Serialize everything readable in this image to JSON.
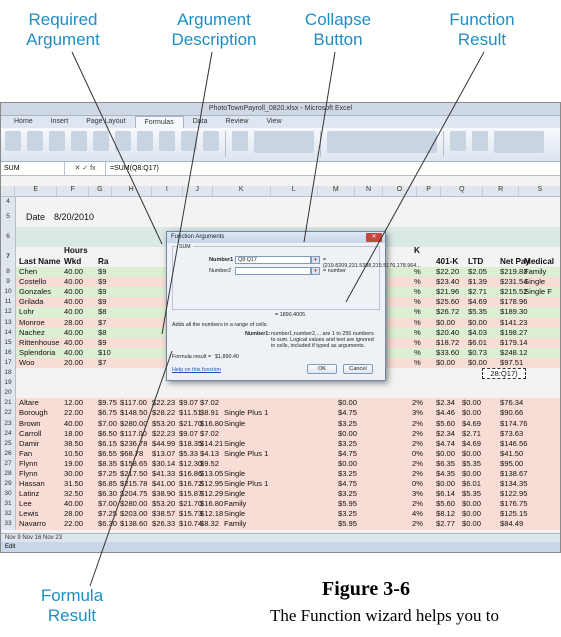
{
  "callouts": {
    "required_argument": [
      "Required",
      "Argument"
    ],
    "argument_description": [
      "Argument",
      "Description"
    ],
    "collapse_button": [
      "Collapse",
      "Button"
    ],
    "function_result": [
      "Function",
      "Result"
    ],
    "formula_result": [
      "Formula",
      "Result"
    ]
  },
  "figure": {
    "number": "Figure 3-6",
    "caption": "The Function wizard helps you to"
  },
  "excel": {
    "title": "PhotoTownPayroll_0820.xlsx - Microsoft Excel",
    "tabs": [
      "Home",
      "Insert",
      "Page Layout",
      "Formulas",
      "Data",
      "Review",
      "View"
    ],
    "active_tab": "Formulas",
    "name_box": "SUM",
    "formula": "=SUM(Q8:Q17)",
    "date_label": "Date",
    "date_value": "8/20/2010",
    "columns": [
      "E",
      "F",
      "G",
      "H",
      "I",
      "J",
      "K",
      "L",
      "M",
      "N",
      "O",
      "P",
      "Q",
      "R",
      "S"
    ],
    "headers": {
      "hours": "Hours",
      "wkd": "Wkd",
      "last_name": "Last Name",
      "rate": "Ra",
      "k": "K",
      "k401": "401-K",
      "ltd": "LTD",
      "net_pay": "Net Pay",
      "medical": "Medical"
    },
    "top_rows": [
      {
        "n": "8",
        "name": "Chen",
        "hours": "40.00",
        "rate": "$9",
        "pct": "%",
        "k401": "$22.20",
        "ltd": "$2.05",
        "net": "$219.83",
        "med": "Family"
      },
      {
        "n": "9",
        "name": "Costello",
        "hours": "40.00",
        "rate": "$9",
        "pct": "%",
        "k401": "$23.40",
        "ltd": "$1.39",
        "net": "$231.54",
        "med": "Single"
      },
      {
        "n": "10",
        "name": "Gonzales",
        "hours": "40.00",
        "rate": "$9",
        "pct": "%",
        "k401": "$21.96",
        "ltd": "$2.71",
        "net": "$215.52",
        "med": "Single F"
      },
      {
        "n": "11",
        "name": "Grilada",
        "hours": "40.00",
        "rate": "$9",
        "pct": "%",
        "k401": "$25.60",
        "ltd": "$4.69",
        "net": "$178.96",
        "med": ""
      },
      {
        "n": "12",
        "name": "Lohr",
        "hours": "40.00",
        "rate": "$8",
        "pct": "%",
        "k401": "$26.72",
        "ltd": "$5.35",
        "net": "$189.30",
        "med": ""
      },
      {
        "n": "13",
        "name": "Monroe",
        "hours": "28.00",
        "rate": "$7",
        "pct": "%",
        "k401": "$0.00",
        "ltd": "$0.00",
        "net": "$141.23",
        "med": ""
      },
      {
        "n": "14",
        "name": "Nachez",
        "hours": "40.00",
        "rate": "$8",
        "pct": "%",
        "k401": "$20.40",
        "ltd": "$4.03",
        "net": "$198.27",
        "med": ""
      },
      {
        "n": "15",
        "name": "Rittenhouse",
        "hours": "40.00",
        "rate": "$9",
        "pct": "%",
        "k401": "$18.72",
        "ltd": "$6.01",
        "net": "$179.14",
        "med": ""
      },
      {
        "n": "16",
        "name": "Splendoria",
        "hours": "40.00",
        "rate": "$10",
        "pct": "%",
        "k401": "$33.60",
        "ltd": "$0.73",
        "net": "$248.12",
        "med": ""
      },
      {
        "n": "17",
        "name": "Woo",
        "hours": "20.00",
        "rate": "$7",
        "pct": "%",
        "k401": "$0.00",
        "ltd": "$0.00",
        "net": "$97.51",
        "med": ""
      }
    ],
    "row18_q": "28:Q17)",
    "bottom_rows": [
      {
        "n": "21",
        "name": "Altare",
        "hours": "12.00",
        "rate": "$9.75",
        "h": "$117.00",
        "i": "$22.23",
        "j": "$9.07",
        "k": "$7.02",
        "l": "",
        "m": "$0.00",
        "pct": "2%",
        "k401": "$2.34",
        "ltd": "$0.00",
        "net": "$76.34"
      },
      {
        "n": "22",
        "name": "Borough",
        "hours": "22.00",
        "rate": "$6.75",
        "h": "$148.50",
        "i": "$28.22",
        "j": "$11.51",
        "k": "$8.91",
        "l": "Single Plus 1",
        "m": "$4.75",
        "pct": "3%",
        "k401": "$4.46",
        "ltd": "$0.00",
        "net": "$90.66"
      },
      {
        "n": "23",
        "name": "Brown",
        "hours": "40.00",
        "rate": "$7.00",
        "h": "$280.00",
        "i": "$53.20",
        "j": "$21.70",
        "k": "$16.80",
        "l": "Single",
        "m": "$3.25",
        "pct": "2%",
        "k401": "$5.60",
        "ltd": "$4.69",
        "net": "$174.76"
      },
      {
        "n": "24",
        "name": "Carroll",
        "hours": "18.00",
        "rate": "$6.50",
        "h": "$117.00",
        "i": "$22.23",
        "j": "$9.07",
        "k": "$7.02",
        "l": "",
        "m": "$0.00",
        "pct": "2%",
        "k401": "$2.34",
        "ltd": "$2.71",
        "net": "$73.63"
      },
      {
        "n": "25",
        "name": "Damir",
        "hours": "38.50",
        "rate": "$6.15",
        "h": "$236.78",
        "i": "$44.99",
        "j": "$18.35",
        "k": "$14.21",
        "l": "Single",
        "m": "$3.25",
        "pct": "2%",
        "k401": "$4.74",
        "ltd": "$4.69",
        "net": "$146.56"
      },
      {
        "n": "26",
        "name": "Fan",
        "hours": "10.50",
        "rate": "$6.55",
        "h": "$68.78",
        "i": "$13.07",
        "j": "$5.33",
        "k": "$4.13",
        "l": "Single Plus 1",
        "m": "$4.75",
        "pct": "0%",
        "k401": "$0.00",
        "ltd": "$0.00",
        "net": "$41.50"
      },
      {
        "n": "27",
        "name": "Flynn",
        "hours": "19.00",
        "rate": "$8.35",
        "h": "$158.65",
        "i": "$30.14",
        "j": "$12.30",
        "k": "$9.52",
        "l": "",
        "m": "$0.00",
        "pct": "2%",
        "k401": "$6.35",
        "ltd": "$5.35",
        "net": "$95.00"
      },
      {
        "n": "28",
        "name": "Flynn",
        "hours": "30.00",
        "rate": "$7.25",
        "h": "$217.50",
        "i": "$41.33",
        "j": "$16.86",
        "k": "$13.05",
        "l": "Single",
        "m": "$3.25",
        "pct": "2%",
        "k401": "$4.35",
        "ltd": "$0.00",
        "net": "$138.67"
      },
      {
        "n": "29",
        "name": "Hassan",
        "hours": "31.50",
        "rate": "$6.85",
        "h": "$215.78",
        "i": "$41.00",
        "j": "$16.72",
        "k": "$12.95",
        "l": "Single Plus 1",
        "m": "$4.75",
        "pct": "0%",
        "k401": "$0.00",
        "ltd": "$6.01",
        "net": "$134.35"
      },
      {
        "n": "30",
        "name": "Latinz",
        "hours": "32.50",
        "rate": "$6.30",
        "h": "$204.75",
        "i": "$38.90",
        "j": "$15.87",
        "k": "$12.29",
        "l": "Single",
        "m": "$3.25",
        "pct": "3%",
        "k401": "$6.14",
        "ltd": "$5.35",
        "net": "$122.95"
      },
      {
        "n": "31",
        "name": "Lee",
        "hours": "40.00",
        "rate": "$7.00",
        "h": "$280.00",
        "i": "$53.20",
        "j": "$21.70",
        "k": "$16.80",
        "l": "Family",
        "m": "$5.95",
        "pct": "2%",
        "k401": "$5.60",
        "ltd": "$0.00",
        "net": "$176.75"
      },
      {
        "n": "32",
        "name": "Lewis",
        "hours": "28.00",
        "rate": "$7.25",
        "h": "$203.00",
        "i": "$38.57",
        "j": "$15.73",
        "k": "$12.18",
        "l": "Single",
        "m": "$3.25",
        "pct": "4%",
        "k401": "$8.12",
        "ltd": "$0.00",
        "net": "$125.15"
      },
      {
        "n": "33",
        "name": "Navarro",
        "hours": "22.00",
        "rate": "$6.30",
        "h": "$138.60",
        "i": "$26.33",
        "j": "$10.74",
        "k": "$8.32",
        "l": "Family",
        "m": "$5.95",
        "pct": "2%",
        "k401": "$2.77",
        "ltd": "$0.00",
        "net": "$84.49"
      }
    ],
    "sheet_tabs": "Nov 9    Nov 16    Nov 23",
    "status": "Edit"
  },
  "dialog": {
    "title": "Function Arguments",
    "function_name": "SUM",
    "number1_label": "Number1",
    "number1_value": "Q8:Q17",
    "number1_preview": "= {219.8209,231.5388,215.5176,178.964...",
    "number2_label": "Number2",
    "number2_preview": "= number",
    "result_preview": "= 1890.4005",
    "description": "Adds all the numbers in a range of cells.",
    "arg_desc_label": "Number1:",
    "arg_desc_text": "number1,number2,... are 1 to 255 numbers to sum. Logical values and text are ignored in cells, included if typed as arguments.",
    "formula_result_label": "Formula result =",
    "formula_result_value": "$1,890.40",
    "help_link": "Help on this function",
    "ok": "OK",
    "cancel": "Cancel"
  }
}
